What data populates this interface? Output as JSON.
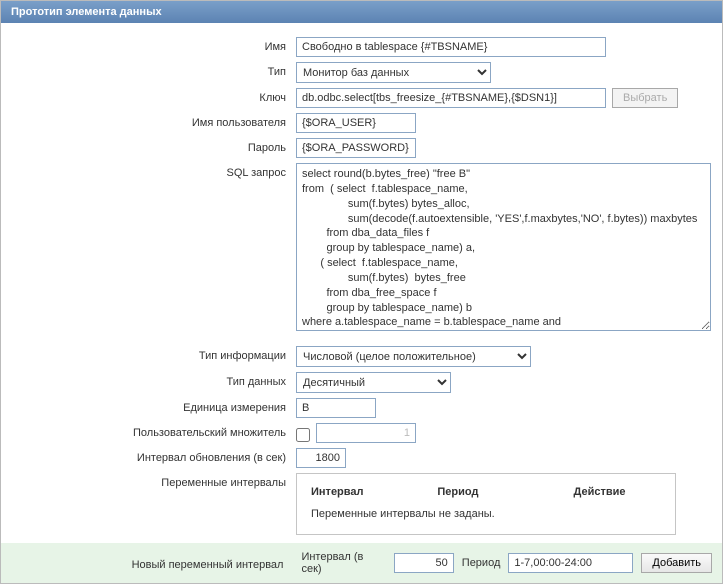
{
  "title": "Прототип элемента данных",
  "fields": {
    "name": {
      "label": "Имя",
      "value": "Свободно в tablespace {#TBSNAME}"
    },
    "type": {
      "label": "Тип",
      "value": "Монитор баз данных"
    },
    "key": {
      "label": "Ключ",
      "value": "db.odbc.select[tbs_freesize_{#TBSNAME},{$DSN1}]",
      "select_button": "Выбрать"
    },
    "username": {
      "label": "Имя пользователя",
      "value": "{$ORA_USER}"
    },
    "password": {
      "label": "Пароль",
      "value": "{$ORA_PASSWORD}"
    },
    "sql": {
      "label": "SQL запрос",
      "value": "select round(b.bytes_free) \"free B\"\nfrom  ( select  f.tablespace_name,\n               sum(f.bytes) bytes_alloc,\n               sum(decode(f.autoextensible, 'YES',f.maxbytes,'NO', f.bytes)) maxbytes\n        from dba_data_files f\n        group by tablespace_name) a,\n      ( select  f.tablespace_name,\n               sum(f.bytes)  bytes_free\n        from dba_free_space f\n        group by tablespace_name) b\nwhere a.tablespace_name = b.tablespace_name and a.tablespace_name='{#TBSNAME}'"
    },
    "info_type": {
      "label": "Тип информации",
      "value": "Числовой (целое положительное)"
    },
    "data_type": {
      "label": "Тип данных",
      "value": "Десятичный"
    },
    "unit": {
      "label": "Единица измерения",
      "value": "B"
    },
    "multiplier": {
      "label": "Пользовательский множитель",
      "value": "1"
    },
    "update_interval": {
      "label": "Интервал обновления (в сек)",
      "value": "1800"
    },
    "flexible": {
      "label": "Переменные интервалы",
      "head_interval": "Интервал",
      "head_period": "Период",
      "head_action": "Действие",
      "empty": "Переменные интервалы не заданы."
    }
  },
  "new_interval": {
    "label": "Новый переменный интервал",
    "interval_label": "Интервал (в сек)",
    "interval_value": "50",
    "period_label": "Период",
    "period_value": "1-7,00:00-24:00",
    "add_button": "Добавить"
  }
}
